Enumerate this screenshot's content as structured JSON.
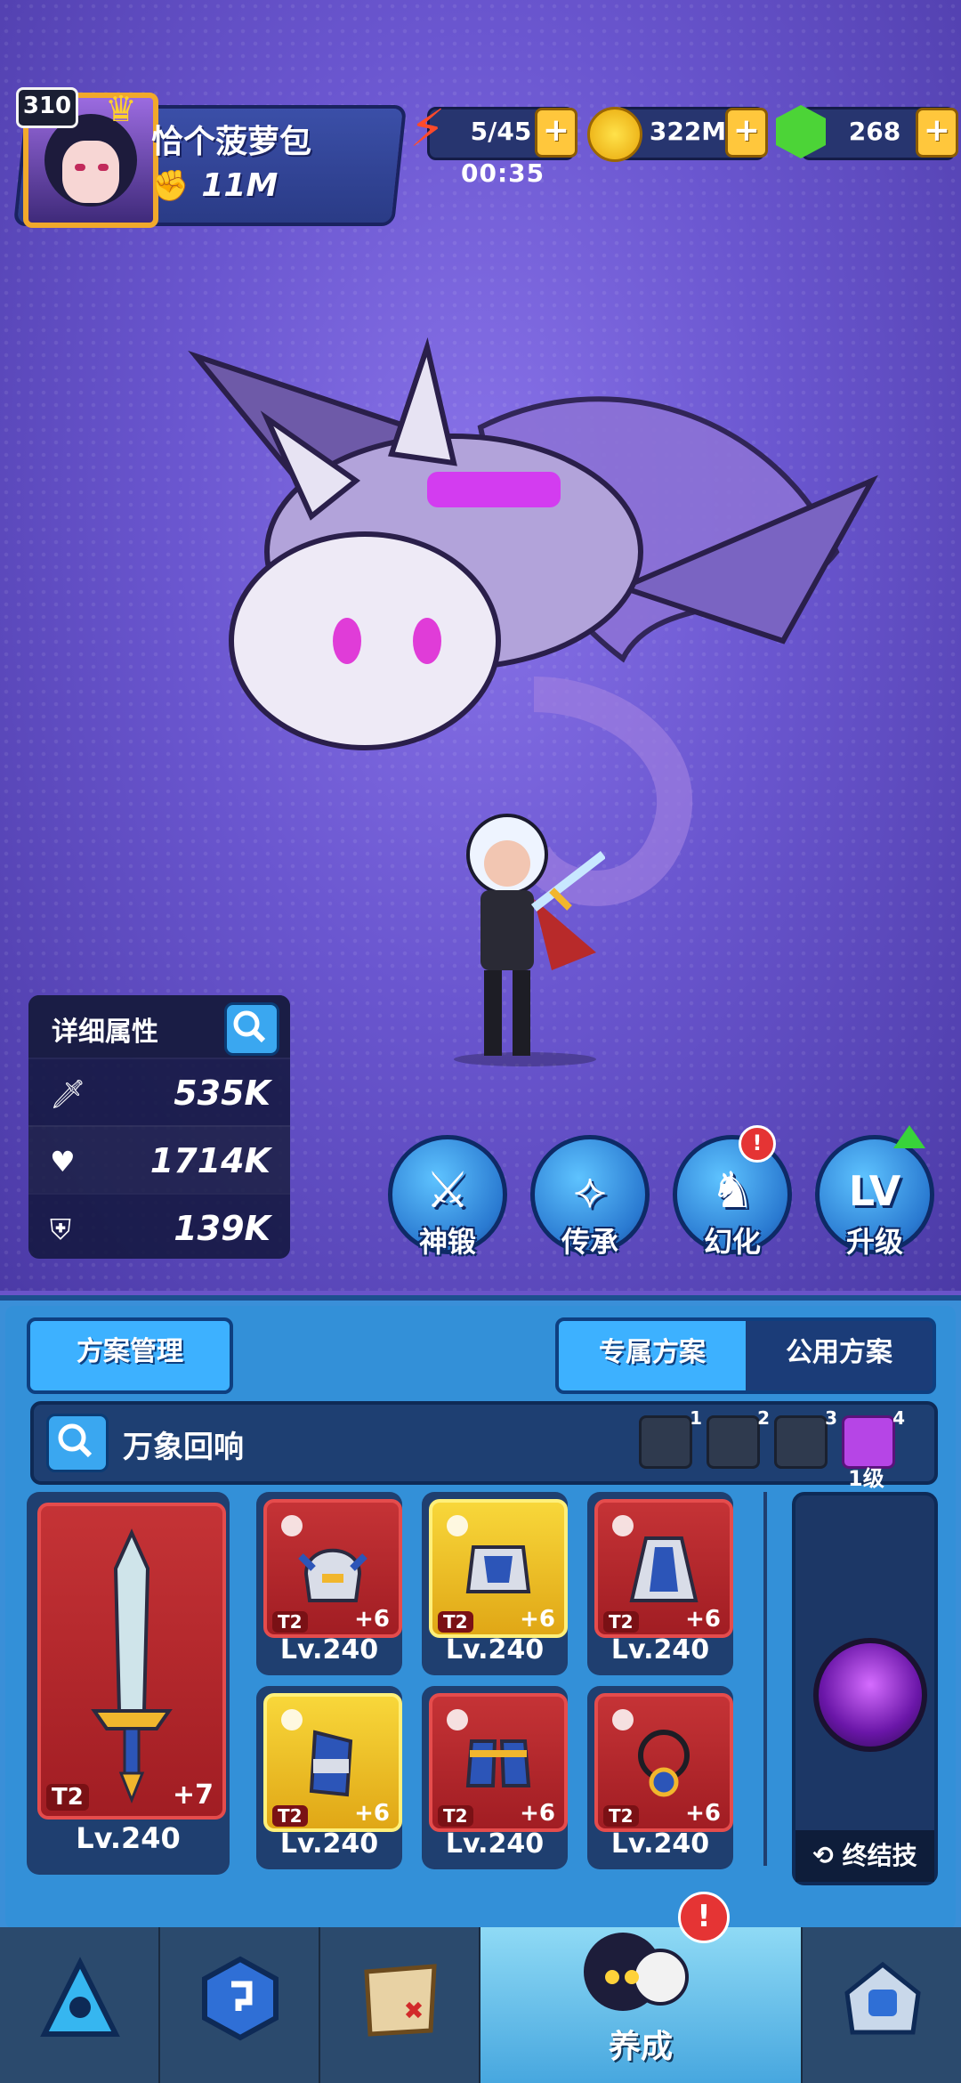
{
  "player": {
    "level": "310",
    "name": "恰个菠萝包",
    "power": "11M"
  },
  "resources": {
    "energy": "5/45",
    "energy_timer": "00:35",
    "gold": "322M",
    "gems": "268",
    "plus": "+"
  },
  "stats_panel": {
    "title": "详细属性",
    "attack": "535K",
    "hp": "1714K",
    "defense": "139K"
  },
  "actions": [
    {
      "label": "神锻"
    },
    {
      "label": "传承"
    },
    {
      "label": "幻化",
      "alert": "!"
    },
    {
      "label": "升级",
      "glyph": "LV"
    }
  ],
  "plan_panel": {
    "manage_button": "方案管理",
    "tab_exclusive": "专属方案",
    "tab_public": "公用方案",
    "set_name": "万象回响",
    "slots": [
      {
        "num": "1"
      },
      {
        "num": "2"
      },
      {
        "num": "3"
      },
      {
        "num": "4",
        "level": "1级"
      }
    ]
  },
  "weapon": {
    "tier": "T2",
    "plus": "+7",
    "level": "Lv.240"
  },
  "gear": [
    {
      "tier": "T2",
      "plus": "+6",
      "level": "Lv.240",
      "rarity": "red"
    },
    {
      "tier": "T2",
      "plus": "+6",
      "level": "Lv.240",
      "rarity": "gold"
    },
    {
      "tier": "T2",
      "plus": "+6",
      "level": "Lv.240",
      "rarity": "red"
    },
    {
      "tier": "T2",
      "plus": "+6",
      "level": "Lv.240",
      "rarity": "gold"
    },
    {
      "tier": "T2",
      "plus": "+6",
      "level": "Lv.240",
      "rarity": "red"
    },
    {
      "tier": "T2",
      "plus": "+6",
      "level": "Lv.240",
      "rarity": "red"
    }
  ],
  "ultimate": {
    "label": "终结技"
  },
  "nav": {
    "active_label": "养成",
    "alert": "!"
  },
  "colors": {
    "bg": "#6a54c9",
    "panel": "#3a8fd8",
    "accent_gold": "#ffc73c",
    "rarity_red": "#c53336",
    "rarity_gold": "#f8d73a"
  }
}
